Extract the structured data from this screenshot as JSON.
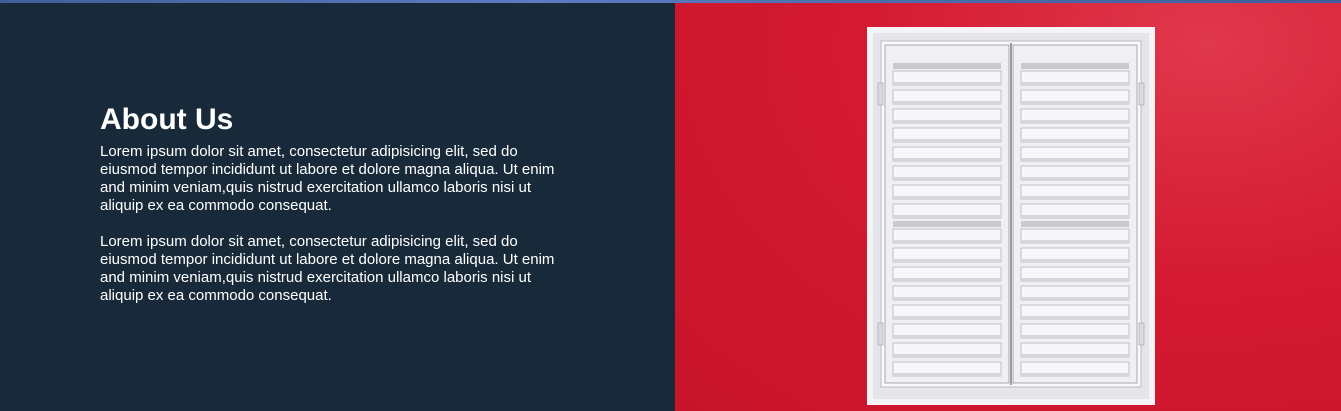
{
  "about": {
    "title": "About Us",
    "paragraphs": [
      "Lorem ipsum dolor sit amet, consectetur adipisicing elit, sed do eiusmod tempor incididunt ut labore et dolore magna aliqua. Ut enim and minim veniam,quis nistrud exercitation ullamco laboris nisi ut aliquip ex ea commodo consequat.",
      "Lorem ipsum dolor sit amet, consectetur adipisicing elit, sed do eiusmod tempor incididunt ut labore et dolore magna aliqua. Ut enim and minim veniam,quis nistrud exercitation ullamco laboris nisi ut aliquip ex ea commodo consequat."
    ]
  },
  "image": {
    "subject": "white-shutter-window-on-red-wall",
    "wall_color": "#d41a31",
    "shutter_color": "#f2f2f4"
  }
}
